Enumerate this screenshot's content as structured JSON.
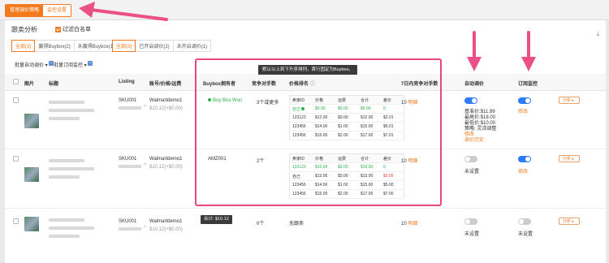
{
  "topbar": {
    "manage_label": "管理调价策略",
    "monitor_label": "监控设置"
  },
  "header": {
    "title": "跟卖分析",
    "filter_label": "过滤白名单",
    "download_icon": "download-icon"
  },
  "segments": {
    "group1": [
      "全部(3)",
      "赢得Buybox(2)",
      "未赢得Buybox(1)"
    ],
    "group2": [
      "全部(3)",
      "已开启调价(2)",
      "未开启调价(1)"
    ]
  },
  "bulk": {
    "reprice": "批量自动调价",
    "subscribe": "批量订阅监控",
    "badge": "?"
  },
  "columns": {
    "image": "图片",
    "title": "标题",
    "listing": "Listing",
    "account": "账号/价格/运费",
    "buybox_owner": "Buybox拥有者",
    "competitors": "竞争对手数",
    "price_rank": "价格排名",
    "competitors_7d": "7日内竞争对手数",
    "auto_reprice": "自动调价",
    "subscribe": "订阅监控"
  },
  "tooltip": "默认以上到下升序排列，首行固定为Buybox。",
  "tooltip_total": "合计: $10.12",
  "mini_headers": [
    "卖家ID",
    "价格",
    "运费",
    "合计",
    "差价"
  ],
  "rows": [
    {
      "listing": "SKU001",
      "account": "Walmartdemo1",
      "price": "$10.12(+$0.00)",
      "buybox": "Buy Box Won",
      "competitors": "3个或更多",
      "competitors_7d": "10",
      "detail_link": "明细",
      "ranks": [
        [
          "自己",
          "$9.99",
          "$0.00",
          "$9.99",
          "0"
        ],
        [
          "123123",
          "$12.00",
          "$0.00",
          "$12.00",
          "$2.01"
        ],
        [
          "123456",
          "$14.00",
          "$1.00",
          "$15.00",
          "$5.01"
        ],
        [
          "123456",
          "$15.00",
          "$2.00",
          "$17.00",
          "$7.01"
        ]
      ],
      "reprice_lines": [
        "基准价:$11.99",
        "最高价:$18.00",
        "最低价:$10.00",
        "策略: 灵活调整"
      ],
      "reprice_links": [
        "修改",
        "调价历史"
      ],
      "reprice_on": true,
      "subscribe_on": true,
      "subscribe_link": "修改",
      "analyze": "分析"
    },
    {
      "listing": "SKU001",
      "account": "Walmartdemo1",
      "price": "$10.12(+$0.00)",
      "buybox": "AMZ001",
      "competitors": "2个",
      "competitors_7d": "10",
      "detail_link": "明细",
      "ranks": [
        [
          "123123",
          "$10.00",
          "$0.00",
          "$10.00",
          "0"
        ],
        [
          "自己",
          "$13.00",
          "$0.00",
          "$13.00",
          "$3.00"
        ],
        [
          "123456",
          "$14.00",
          "$1.00",
          "$15.00",
          "$5.00"
        ],
        [
          "123456",
          "$15.00",
          "$2.00",
          "$17.00",
          "$7.00"
        ]
      ],
      "reprice_status": "未设置",
      "reprice_on": false,
      "subscribe_on": true,
      "subscribe_link": "修改",
      "analyze": "分析"
    },
    {
      "listing": "SKU001",
      "account": "Walmartdemo1",
      "price": "$10.12(+$0.00)",
      "buybox": "合计: $10.12",
      "competitors": "0个",
      "price_rank": "无跟卖",
      "competitors_7d": "10",
      "detail_link": "明细",
      "reprice_status": "未设置",
      "reprice_on": false,
      "subscribe_on": false,
      "subscribe_status": "未设置",
      "analyze": "分析"
    }
  ],
  "colors": {
    "accent": "#f47a1f",
    "highlight": "#e9457e",
    "toggle_on": "#2f7cf6",
    "buybox_green": "#2bb24c"
  }
}
